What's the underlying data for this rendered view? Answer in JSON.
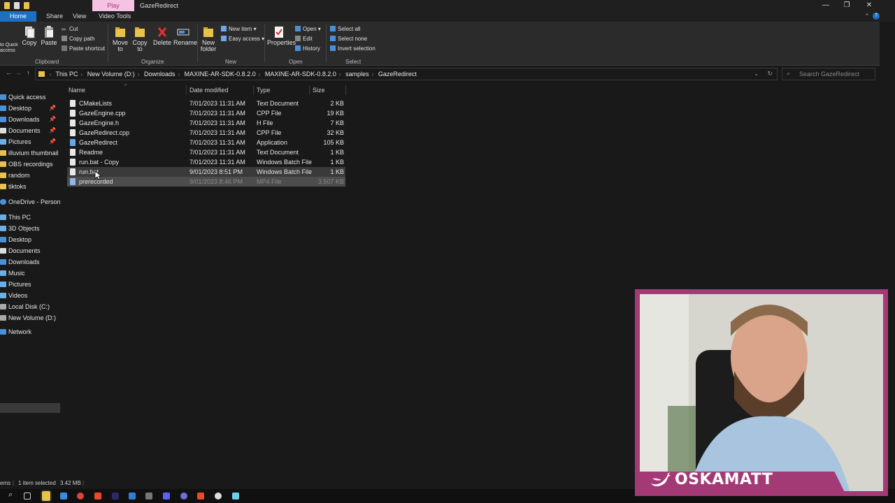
{
  "titlebar": {
    "contextual_tab": "Play",
    "window_title": "GazeRedirect"
  },
  "ribbon_tabs": [
    "Home",
    "Share",
    "View",
    "Video Tools"
  ],
  "ribbon": {
    "clipboard": {
      "label": "Clipboard",
      "pin_label": "to Quick access",
      "copy": "Copy",
      "paste": "Paste",
      "cut": "Cut",
      "copy_path": "Copy path",
      "paste_shortcut": "Paste shortcut"
    },
    "organize": {
      "label": "Organize",
      "move_to": "Move to",
      "copy_to": "Copy to",
      "delete": "Delete",
      "rename": "Rename"
    },
    "new": {
      "label": "New",
      "new_folder": "New folder",
      "new_item": "New item",
      "easy_access": "Easy access"
    },
    "open": {
      "label": "Open",
      "properties": "Properties",
      "open": "Open",
      "edit": "Edit",
      "history": "History"
    },
    "select": {
      "label": "Select",
      "select_all": "Select all",
      "select_none": "Select none",
      "invert_selection": "Invert selection"
    }
  },
  "address": {
    "crumbs": [
      "This PC",
      "New Volume (D:)",
      "Downloads",
      "MAXINE-AR-SDK-0.8.2.0",
      "MAXINE-AR-SDK-0.8.2.0",
      "samples",
      "GazeRedirect"
    ],
    "search_placeholder": "Search GazeRedirect"
  },
  "nav": {
    "quick_access": "Quick access",
    "quick_items": [
      "Desktop",
      "Downloads",
      "Documents",
      "Pictures",
      "illuvium thumbnail",
      "OBS recordings",
      "random",
      "tiktoks"
    ],
    "onedrive": "OneDrive - Personal",
    "this_pc": "This PC",
    "pc_items": [
      "3D Objects",
      "Desktop",
      "Documents",
      "Downloads",
      "Music",
      "Pictures",
      "Videos",
      "Local Disk (C:)",
      "New Volume (D:)"
    ],
    "network": "Network"
  },
  "columns": {
    "name": "Name",
    "date": "Date modified",
    "type": "Type",
    "size": "Size"
  },
  "files": [
    {
      "name": "CMakeLists",
      "date": "7/01/2023 11:31 AM",
      "type": "Text Document",
      "size": "2 KB"
    },
    {
      "name": "GazeEngine.cpp",
      "date": "7/01/2023 11:31 AM",
      "type": "CPP File",
      "size": "19 KB"
    },
    {
      "name": "GazeEngine.h",
      "date": "7/01/2023 11:31 AM",
      "type": "H File",
      "size": "7 KB"
    },
    {
      "name": "GazeRedirect.cpp",
      "date": "7/01/2023 11:31 AM",
      "type": "CPP File",
      "size": "32 KB"
    },
    {
      "name": "GazeRedirect",
      "date": "7/01/2023 11:31 AM",
      "type": "Application",
      "size": "105 KB"
    },
    {
      "name": "Readme",
      "date": "7/01/2023 11:31 AM",
      "type": "Text Document",
      "size": "1 KB"
    },
    {
      "name": "run.bat - Copy",
      "date": "7/01/2023 11:31 AM",
      "type": "Windows Batch File",
      "size": "1 KB"
    },
    {
      "name": "run.bat",
      "date": "9/01/2023 8:51 PM",
      "type": "Windows Batch File",
      "size": "1 KB"
    },
    {
      "name": "prerecorded",
      "date": "9/01/2023 8:46 PM",
      "type": "MP4 File",
      "size": "3,507 KB"
    }
  ],
  "status": {
    "items": "ems",
    "selected": "1 item selected",
    "size": "3.42 MB"
  },
  "overlay": {
    "handle": "OSKAMATT"
  }
}
